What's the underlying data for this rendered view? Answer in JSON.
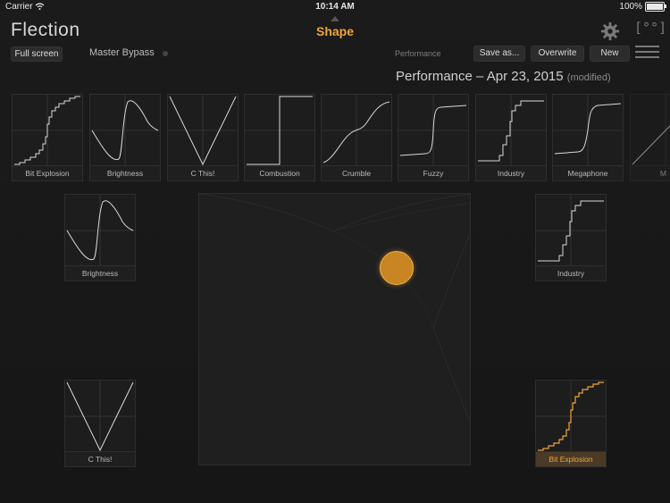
{
  "status_bar": {
    "carrier": "Carrier",
    "time": "10:14 AM",
    "battery": "100%"
  },
  "app": {
    "logo": "Flection",
    "title": "Shape"
  },
  "toolbar": {
    "full_screen": "Full screen",
    "master_bypass": "Master Bypass",
    "performance_label": "Performance",
    "save_as": "Save as...",
    "overwrite": "Overwrite",
    "new": "New"
  },
  "preset": {
    "name": "Performance – Apr 23, 2015",
    "modified": "(modified)"
  },
  "shapes": [
    {
      "label": "Bit Explosion"
    },
    {
      "label": "Brightness"
    },
    {
      "label": "C This!"
    },
    {
      "label": "Combustion"
    },
    {
      "label": "Crumble"
    },
    {
      "label": "Fuzzy"
    },
    {
      "label": "Industry"
    },
    {
      "label": "Megaphone"
    },
    {
      "label": "M"
    }
  ],
  "corners": {
    "top_left": "Brightness",
    "top_right": "Industry",
    "bottom_left": "C This!",
    "bottom_right": "Bit Explosion"
  },
  "colors": {
    "accent": "#f0a53a",
    "curve": "#d9d9d9"
  },
  "icons": {
    "settings": "gear-icon",
    "view": "brackets-icon",
    "menu": "hamburger-icon",
    "wifi": "wifi-icon"
  }
}
